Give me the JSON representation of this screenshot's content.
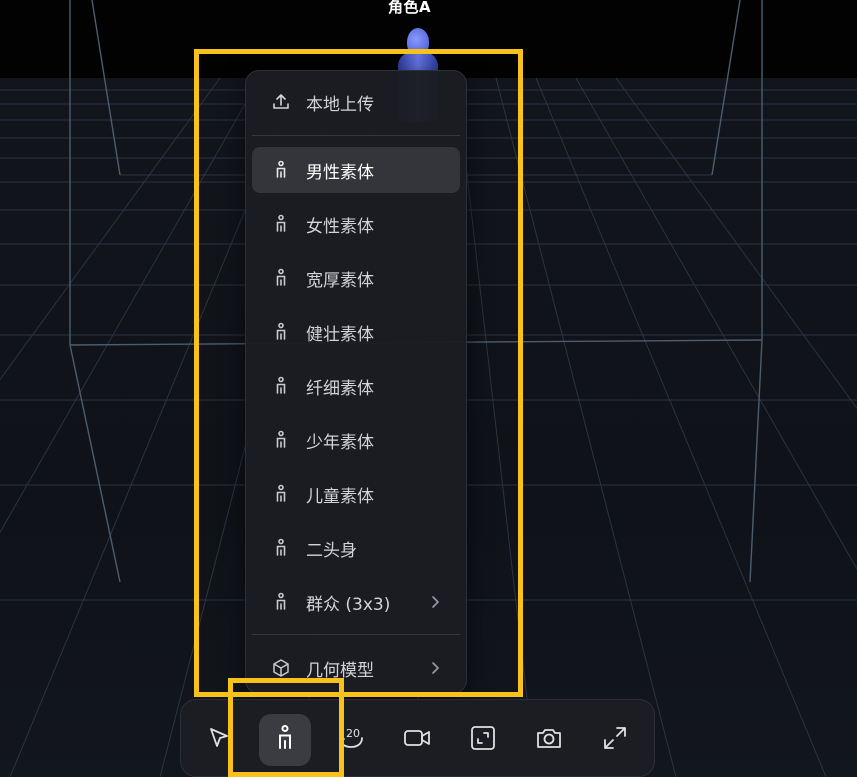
{
  "scene": {
    "character_label": "角色A"
  },
  "menu": {
    "upload": {
      "label": "本地上传",
      "icon": "upload-icon"
    },
    "body_items": [
      {
        "label": "男性素体",
        "icon": "person-icon",
        "active": true
      },
      {
        "label": "女性素体",
        "icon": "person-icon"
      },
      {
        "label": "宽厚素体",
        "icon": "person-icon"
      },
      {
        "label": "健壮素体",
        "icon": "person-icon"
      },
      {
        "label": "纤细素体",
        "icon": "person-icon"
      },
      {
        "label": "少年素体",
        "icon": "person-icon"
      },
      {
        "label": "儿童素体",
        "icon": "person-icon"
      },
      {
        "label": "二头身",
        "icon": "person-icon"
      },
      {
        "label": "群众 (3x3)",
        "icon": "person-icon",
        "submenu": true
      }
    ],
    "geometry": {
      "label": "几何模型",
      "icon": "cube-icon",
      "submenu": true
    }
  },
  "toolbar": {
    "tools": [
      {
        "name": "select-tool",
        "icon": "pointer-icon"
      },
      {
        "name": "person-tool",
        "icon": "person-icon",
        "active": true
      },
      {
        "name": "rotate-tool",
        "icon": "rotate-icon",
        "text": "20"
      },
      {
        "name": "camera-tool",
        "icon": "video-camera-icon"
      },
      {
        "name": "frame-tool",
        "icon": "frame-icon"
      },
      {
        "name": "screenshot-tool",
        "icon": "camera-icon"
      },
      {
        "name": "fullscreen-tool",
        "icon": "expand-icon"
      }
    ]
  },
  "colors": {
    "highlight": "#f9c21b",
    "menu_bg": "#1b1d22",
    "active_item_bg": "#33353b",
    "grid_line": "#3a4a5c"
  }
}
